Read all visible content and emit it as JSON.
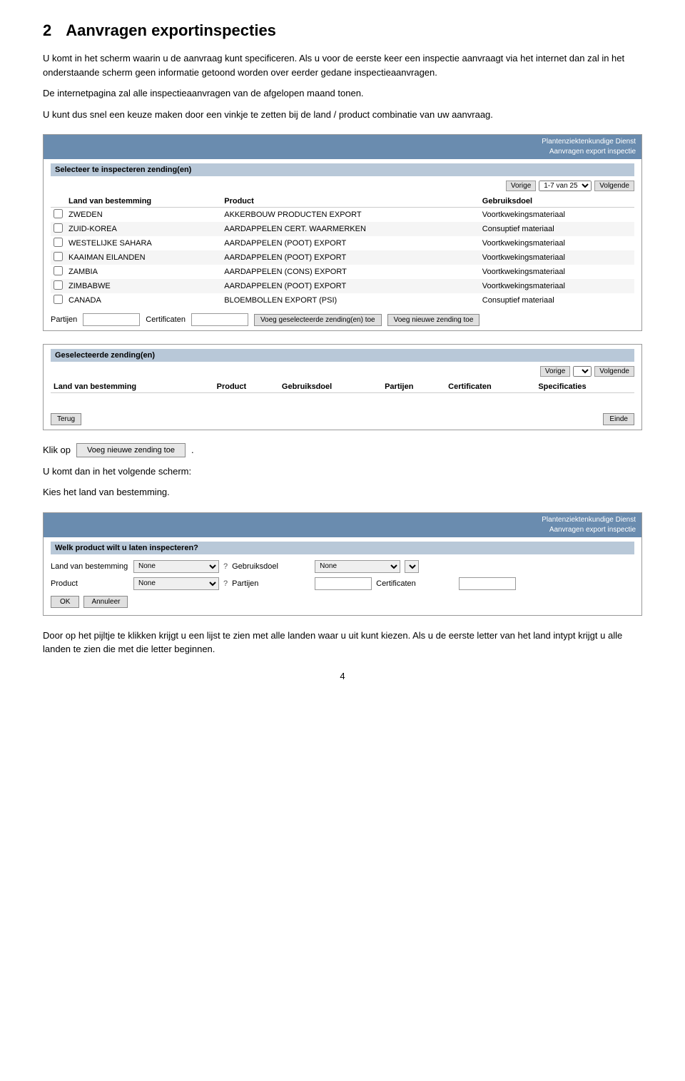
{
  "section": {
    "number": "2",
    "title": "Aanvragen exportinspecties"
  },
  "paragraphs": {
    "p1": "U komt in het scherm waarin u de aanvraag kunt specificeren. Als u voor de eerste keer een inspectie aanvraagt via het internet dan zal in het onderstaande scherm geen informatie getoond worden over eerder gedane inspectieaanvragen.",
    "p2": "De internetpagina zal alle inspectieaanvragen van de afgelopen maand tonen.",
    "p3": "U kunt dus snel een keuze maken door een vinkje te zetten bij de land / product combinatie van uw aanvraag."
  },
  "screen1": {
    "header_line1": "Plantenziektenkundige Dienst",
    "header_line2": "Aanvragen export inspectie",
    "section_label": "Selecteer te inspecteren zending(en)",
    "pagination": {
      "vorige": "Vorige",
      "range": "1-7 van 25",
      "volgende": "Volgende"
    },
    "table": {
      "columns": [
        "",
        "Land van bestemming",
        "Product",
        "Gebruiksdoel"
      ],
      "rows": [
        {
          "checked": false,
          "land": "ZWEDEN",
          "product": "AKKERBOUW PRODUCTEN EXPORT",
          "gebruik": "Voortkwekingsmateriaal"
        },
        {
          "checked": false,
          "land": "ZUID-KOREA",
          "product": "AARDAPPELEN CERT. WAARMERKEN",
          "gebruik": "Consuptief materiaal"
        },
        {
          "checked": false,
          "land": "WESTELIJKE SAHARA",
          "product": "AARDAPPELEN (POOT) EXPORT",
          "gebruik": "Voortkwekingsmateriaal"
        },
        {
          "checked": false,
          "land": "KAAIMAN EILANDEN",
          "product": "AARDAPPELEN (POOT) EXPORT",
          "gebruik": "Voortkwekingsmateriaal"
        },
        {
          "checked": false,
          "land": "ZAMBIA",
          "product": "AARDAPPELEN (CONS) EXPORT",
          "gebruik": "Voortkwekingsmateriaal"
        },
        {
          "checked": false,
          "land": "ZIMBABWE",
          "product": "AARDAPPELEN (POOT) EXPORT",
          "gebruik": "Voortkwekingsmateriaal"
        },
        {
          "checked": false,
          "land": "CANADA",
          "product": "BLOEMBOLLEN EXPORT (PSI)",
          "gebruik": "Consuptief materiaal"
        }
      ]
    },
    "bottom": {
      "partijen_label": "Partijen",
      "certificaten_label": "Certificaten",
      "voeg_geselecteerde_btn": "Voeg geselecteerde zending(en) toe",
      "voeg_nieuwe_btn": "Voeg nieuwe zending toe"
    }
  },
  "screen2": {
    "section_label": "Geselecteerde zending(en)",
    "pagination": {
      "vorige": "Vorige",
      "volgende": "Volgende"
    },
    "table": {
      "columns": [
        "Land van bestemming",
        "Product",
        "Gebruiksdoel",
        "Partijen",
        "Certificaten",
        "Specificaties"
      ]
    },
    "buttons": {
      "terug": "Terug",
      "einde": "Einde"
    }
  },
  "klik_op": {
    "label": "Klik op",
    "button": "Voeg nieuwe zending toe",
    "dot": "."
  },
  "next_screen_text": {
    "p1": "U komt dan in het volgende scherm:",
    "p2": "Kies het land van bestemming."
  },
  "form_screen": {
    "header_line1": "Plantenziektenkundige Dienst",
    "header_line2": "Aanvragen export inspectie",
    "section_label": "Welk product wilt u laten inspecteren?",
    "fields": {
      "land_label": "Land van bestemming",
      "land_value": "None",
      "gebruik_label": "Gebruiksdoel",
      "gebruik_value": "None",
      "product_label": "Product",
      "product_value": "None",
      "partijen_label": "Partijen",
      "certificaten_label": "Certificaten"
    },
    "buttons": {
      "ok": "OK",
      "annuleer": "Annuleer"
    }
  },
  "final_text": {
    "p1": "Door op het pijltje te klikken krijgt u een lijst te zien met alle landen waar u uit kunt kiezen. Als u de eerste letter van het land intypt krijgt u alle landen te zien die met die letter beginnen."
  },
  "page_number": "4"
}
